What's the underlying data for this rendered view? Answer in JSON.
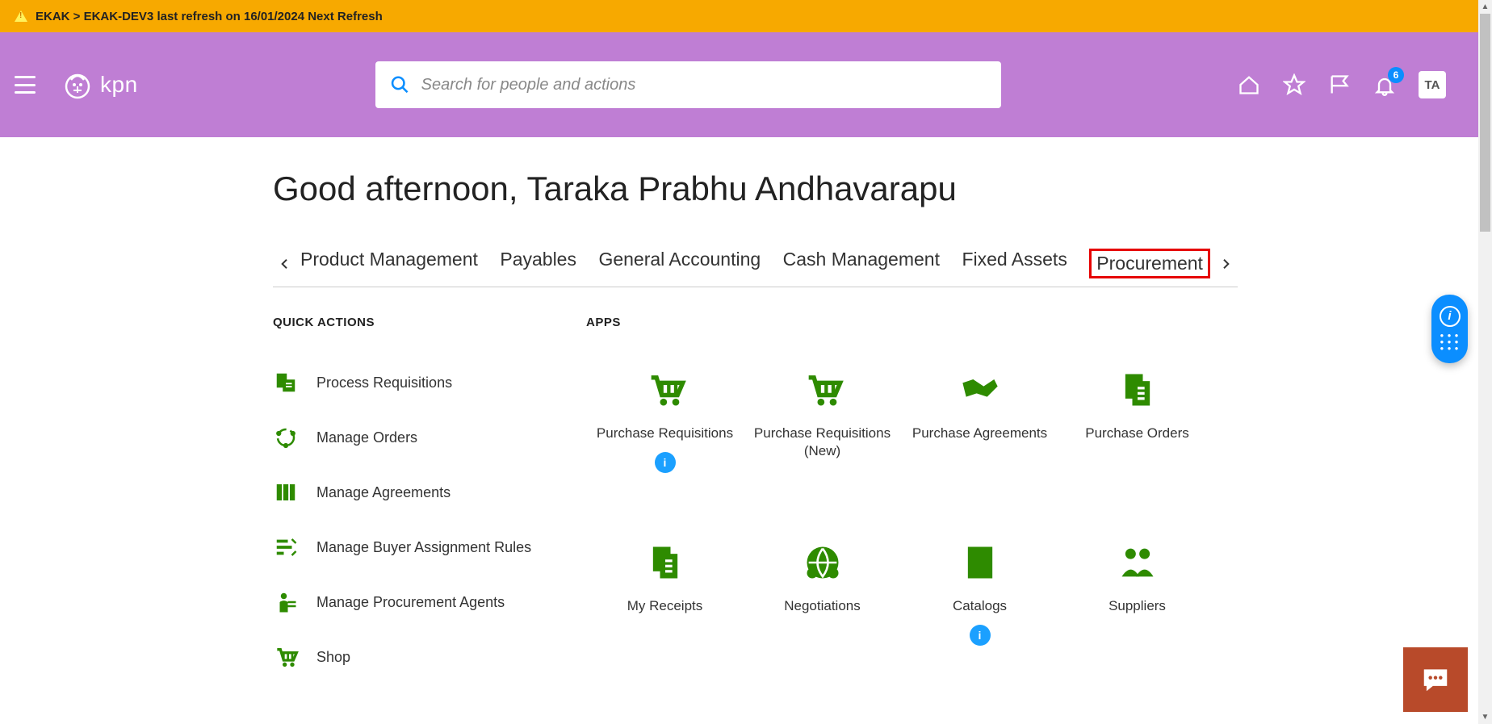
{
  "notification": {
    "text": "EKAK > EKAK-DEV3 last refresh on 16/01/2024 Next Refresh"
  },
  "header": {
    "logo_text": "kpn",
    "search_placeholder": "Search for people and actions",
    "notification_count": "6",
    "avatar_initials": "TA"
  },
  "greeting": "Good afternoon, Taraka Prabhu Andhavarapu",
  "tabs": [
    {
      "label": "Product Management",
      "name": "tab-product-management"
    },
    {
      "label": "Payables",
      "name": "tab-payables"
    },
    {
      "label": "General Accounting",
      "name": "tab-general-accounting"
    },
    {
      "label": "Cash Management",
      "name": "tab-cash-management"
    },
    {
      "label": "Fixed Assets",
      "name": "tab-fixed-assets"
    },
    {
      "label": "Procurement",
      "name": "tab-procurement",
      "active": true
    }
  ],
  "section_titles": {
    "quick_actions": "QUICK ACTIONS",
    "apps": "APPS"
  },
  "quick_actions": [
    {
      "label": "Process Requisitions",
      "icon": "doc-list-icon",
      "name": "qa-process-requisitions"
    },
    {
      "label": "Manage Orders",
      "icon": "cycle-icon",
      "name": "qa-manage-orders"
    },
    {
      "label": "Manage Agreements",
      "icon": "books-icon",
      "name": "qa-manage-agreements"
    },
    {
      "label": "Manage Buyer Assignment Rules",
      "icon": "lines-icon",
      "name": "qa-manage-buyer-assignment-rules"
    },
    {
      "label": "Manage Procurement Agents",
      "icon": "person-icon",
      "name": "qa-manage-procurement-agents"
    },
    {
      "label": "Shop",
      "icon": "cart-icon",
      "name": "qa-shop"
    }
  ],
  "apps": [
    {
      "label": "Purchase Requisitions",
      "icon": "cart-icon",
      "name": "app-purchase-requisitions",
      "info": true
    },
    {
      "label": "Purchase Requisitions (New)",
      "icon": "cart-icon",
      "name": "app-purchase-requisitions-new"
    },
    {
      "label": "Purchase Agreements",
      "icon": "handshake-icon",
      "name": "app-purchase-agreements"
    },
    {
      "label": "Purchase Orders",
      "icon": "docs-icon",
      "name": "app-purchase-orders"
    },
    {
      "label": "My Receipts",
      "icon": "docs-icon",
      "name": "app-my-receipts"
    },
    {
      "label": "Negotiations",
      "icon": "globe-people-icon",
      "name": "app-negotiations"
    },
    {
      "label": "Catalogs",
      "icon": "book-icon",
      "name": "app-catalogs",
      "info": true
    },
    {
      "label": "Suppliers",
      "icon": "people-icon",
      "name": "app-suppliers"
    }
  ],
  "info_char": "i"
}
